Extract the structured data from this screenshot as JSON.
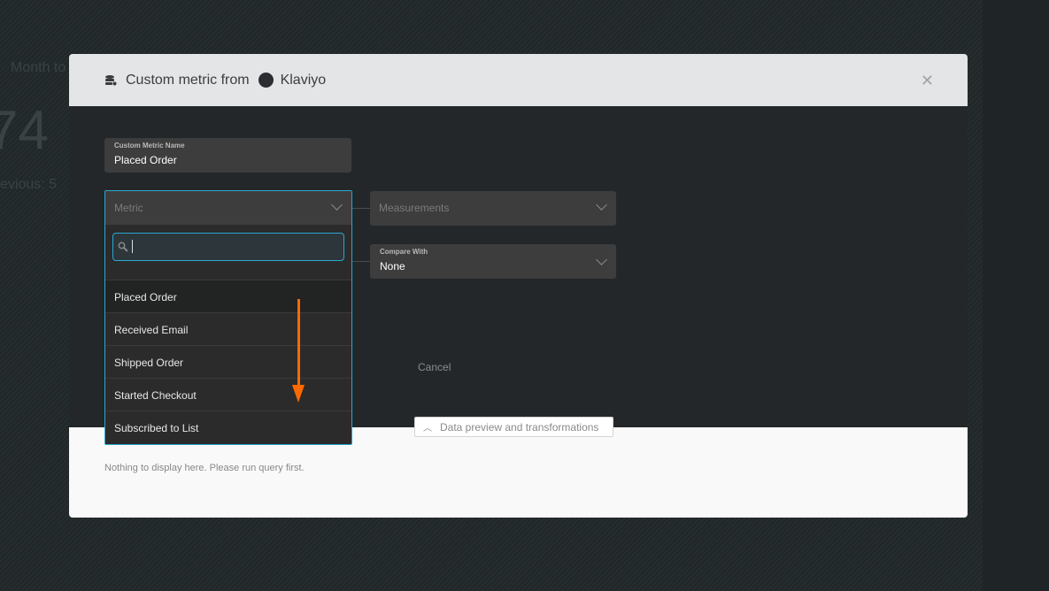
{
  "background": {
    "label": "Month to",
    "value": "74",
    "previous": "evious: 5"
  },
  "modal": {
    "title": "Custom metric from",
    "source": "Klaviyo",
    "close_icon": "close-icon"
  },
  "form": {
    "name_label": "Custom Metric Name",
    "name_value": "Placed Order",
    "metric_placeholder": "Metric",
    "measurements_placeholder": "Measurements",
    "compare_label": "Compare With",
    "compare_value": "None",
    "cancel": "Cancel"
  },
  "dropdown": {
    "search_value": "",
    "options": [
      "Placed Order",
      "Received Email",
      "Shipped Order",
      "Started Checkout",
      "Subscribed to List"
    ]
  },
  "preview": {
    "toggle_label": "Data preview and transformations",
    "empty_text": "Nothing to display here. Please run query first."
  },
  "colors": {
    "accent": "#2aa7d0",
    "annotation_arrow": "#ff6a00"
  }
}
